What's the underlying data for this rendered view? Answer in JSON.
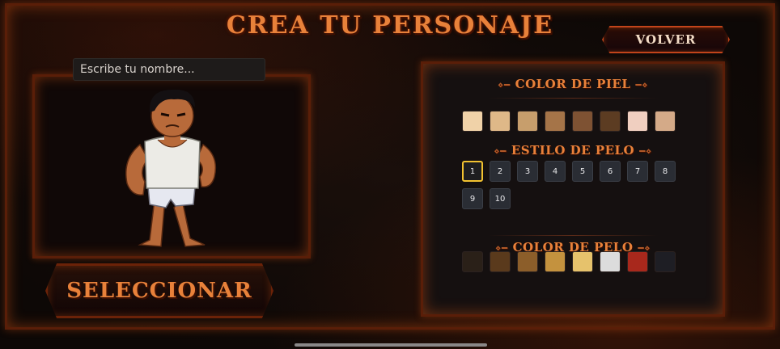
{
  "title": "CREA TU PERSONAJE",
  "back_button": "VOLVER",
  "name_input": {
    "placeholder": "Escribe tu nombre...",
    "value": ""
  },
  "select_button": "SELECCIONAR",
  "skin_section": {
    "title": "COLOR DE PIEL",
    "colors": [
      "#f0d2a8",
      "#dfb888",
      "#c79e6c",
      "#a57448",
      "#7e5233",
      "#5c3c22",
      "#f0cfc0",
      "#d4aa88"
    ]
  },
  "hair_style_section": {
    "title": "ESTILO DE PELO",
    "styles": [
      "1",
      "2",
      "3",
      "4",
      "5",
      "6",
      "7",
      "8",
      "9",
      "10"
    ],
    "selected": "1"
  },
  "hair_color_section": {
    "title": "COLOR DE PELO",
    "colors": [
      "#2a2018",
      "#5a3a1c",
      "#8c5e2a",
      "#c4923e",
      "#e6c26c",
      "#dcdcdc",
      "#a8281c",
      "#1e1e24"
    ]
  },
  "accent_color": "#e8813a"
}
